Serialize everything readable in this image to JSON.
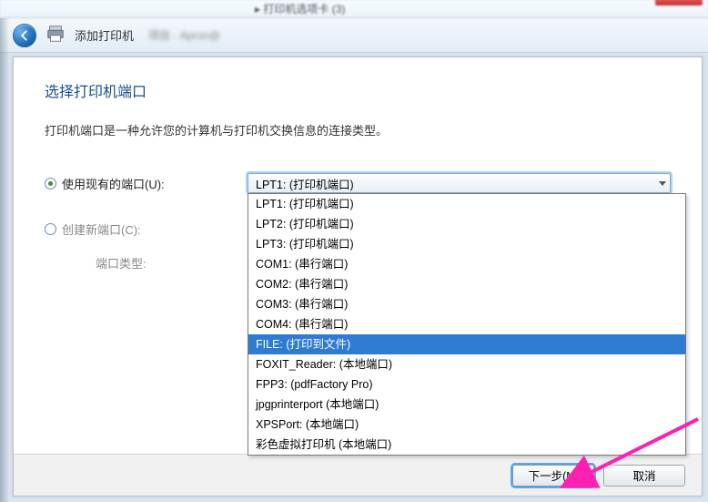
{
  "breadcrumb": {
    "text": "▸ 打印机选项卡 (3)"
  },
  "header": {
    "title": "添加打印机",
    "blur_text": "项目 · Apron@"
  },
  "main": {
    "heading": "选择打印机端口",
    "subtext": "打印机端口是一种允许您的计算机与打印机交换信息的连接类型。",
    "radio_use_existing": "使用现有的端口(U):",
    "radio_create_new": "创建新端口(C):",
    "port_type_label": "端口类型:"
  },
  "dropdown": {
    "selected_label": "LPT1: (打印机端口)",
    "items": [
      "LPT1: (打印机端口)",
      "LPT2: (打印机端口)",
      "LPT3: (打印机端口)",
      "COM1: (串行端口)",
      "COM2: (串行端口)",
      "COM3: (串行端口)",
      "COM4: (串行端口)",
      "FILE: (打印到文件)",
      "FOXIT_Reader: (本地端口)",
      "FPP3: (pdfFactory Pro)",
      "jpgprinterport (本地端口)",
      "XPSPort: (本地端口)",
      "彩色虚拟打印机 (本地端口)"
    ],
    "highlighted_index": 7
  },
  "footer": {
    "next": "下一步(N)",
    "cancel": "取消"
  }
}
